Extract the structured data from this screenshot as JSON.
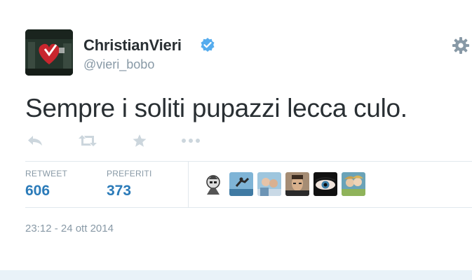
{
  "tweet": {
    "author_name": "ChristianVieri",
    "author_handle": "@vieri_bobo",
    "text": "Sempre i soliti pupazzi lecca culo.",
    "timestamp": "23:12 - 24 ott 2014"
  },
  "icons": {
    "verified": "verified-badge-icon",
    "settings": "gear-icon",
    "reply": "reply-icon",
    "retweet": "retweet-icon",
    "favorite": "star-icon",
    "more": "more-dots-icon"
  },
  "stats": {
    "retweets_label": "RETWEET",
    "retweets_value": "606",
    "favorites_label": "PREFERITI",
    "favorites_value": "373"
  },
  "colors": {
    "link_blue": "#2b7bb9",
    "muted_gray": "#8899a6",
    "text_dark": "#292f33",
    "verified_blue": "#55acee"
  }
}
